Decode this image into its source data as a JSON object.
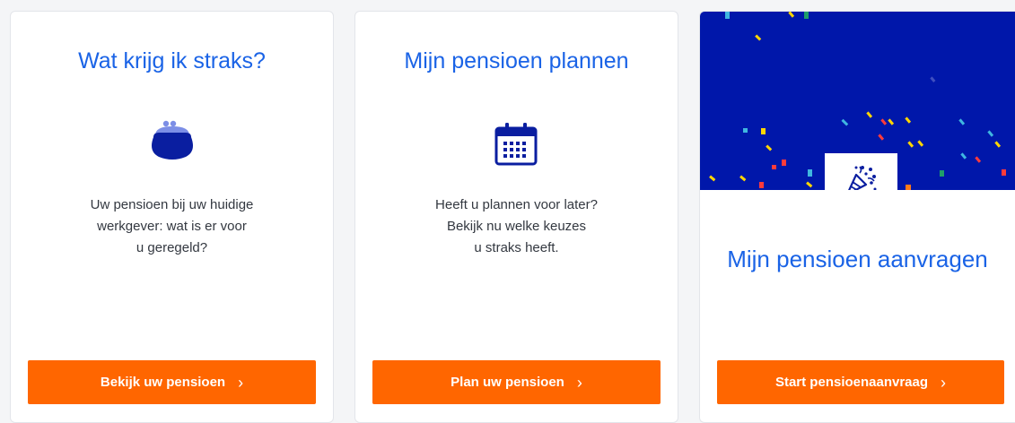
{
  "cards": [
    {
      "title": "Wat krijg ik straks?",
      "icon": "coin-purse-icon",
      "text_lines": [
        "Uw pensioen bij uw huidige",
        "werkgever: wat is er voor",
        "u geregeld?"
      ],
      "button_label": "Bekijk uw pensioen"
    },
    {
      "title": "Mijn pensioen plannen",
      "icon": "calendar-icon",
      "text_lines": [
        "Heeft u plannen voor later?",
        "Bekijk nu welke keuzes",
        "u straks heeft."
      ],
      "button_label": "Plan uw pensioen"
    },
    {
      "title": "Mijn pensioen aanvragen",
      "icon": "party-popper-icon",
      "banner": "confetti-banner",
      "button_label": "Start pensioenaanvraag"
    }
  ],
  "colors": {
    "accent_blue": "#1a63e6",
    "icon_navy": "#0a1ea0",
    "button_orange": "#ff6600",
    "banner_blue": "#0017aa"
  }
}
